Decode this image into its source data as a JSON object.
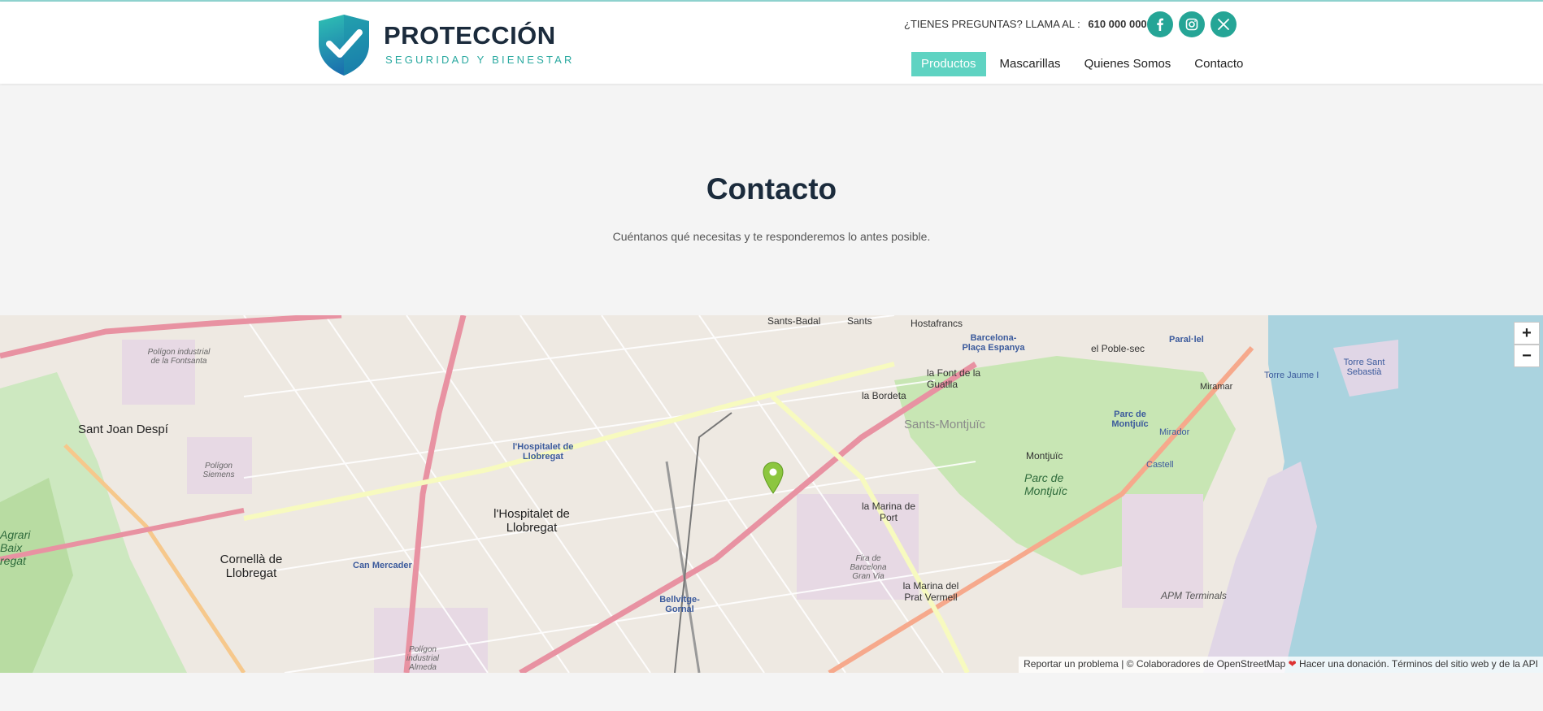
{
  "header": {
    "brand": "PROTECCIÓN",
    "tagline": "SEGURIDAD Y BIENESTAR",
    "contact_prompt": "¿TIENES PREGUNTAS? LLAMA AL :",
    "phone": "610 000 000",
    "social": [
      "facebook-icon",
      "instagram-icon",
      "x-icon"
    ],
    "nav": [
      {
        "label": "Productos",
        "active": true
      },
      {
        "label": "Mascarillas",
        "active": false
      },
      {
        "label": "Quienes Somos",
        "active": false
      },
      {
        "label": "Contacto",
        "active": false
      }
    ]
  },
  "hero": {
    "title": "Contacto",
    "subtitle": "Cuéntanos qué necesitas y te responderemos lo antes posible."
  },
  "map": {
    "zoom_in": "+",
    "zoom_out": "−",
    "labels": {
      "sants_badal": "Sants-Badal",
      "sants": "Sants",
      "hostafrancs": "Hostafrancs",
      "barcelona_plaza": "Barcelona-Plaça Espanya",
      "poble_sec": "el Poble-sec",
      "paral_lel": "Paral·lel",
      "sant_joan_despi": "Sant Joan Despí",
      "font_guatlla": "la Font de la Guatlla",
      "bordeta": "la Bordeta",
      "sants_montjuic": "Sants-Montjuïc",
      "montjuic": "Montjuïc",
      "parc_montjuic": "Parc de Montjuïc",
      "hospitalet_station": "l'Hospitalet de Llobregat",
      "hospitalet": "l'Hospitalet de Llobregat",
      "marina_port": "la Marina de Port",
      "cornella": "Cornellà de Llobregat",
      "can_mercader": "Can Mercader",
      "bellvitge": "Bellvitge-Gornal",
      "marina_prat": "la Marina del Prat Vermell",
      "fira": "Fira de Barcelona Gran Via",
      "apm": "APM Terminals",
      "miramar": "Miramar",
      "torre_jaume": "Torre Jaume I",
      "torre_sebastia": "Torre Sant Sebastià",
      "mirador": "Mirador",
      "castell": "Castell",
      "parc_montjuic_station": "Parc de Montjuïc",
      "poligon_siemens": "Polígon Siemens",
      "poligon_fontsanta": "Polígon industrial de la Fontsanta",
      "poligon_almeda": "Polígon industrial Almeda",
      "agrari": "Agrari Baix regat"
    },
    "attribution": {
      "report": "Reportar un problema",
      "osm": "© Colaboradores de OpenStreetMap",
      "donate": "Hacer una donación.",
      "terms": "Términos del sitio web y de la API"
    }
  }
}
